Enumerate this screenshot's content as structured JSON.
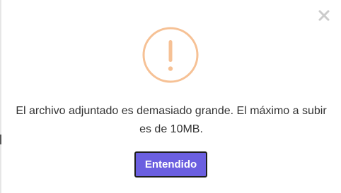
{
  "dialog": {
    "message": "El archivo adjuntado es demasiado grande. El máximo a subir es de 10MB.",
    "confirm_label": "Entendido",
    "icon": "warning-exclamation-icon",
    "close_icon": "close-icon"
  },
  "colors": {
    "warning": "#f6c195",
    "button": "#6b5fe0",
    "close": "#cccccc",
    "text": "#333333"
  }
}
